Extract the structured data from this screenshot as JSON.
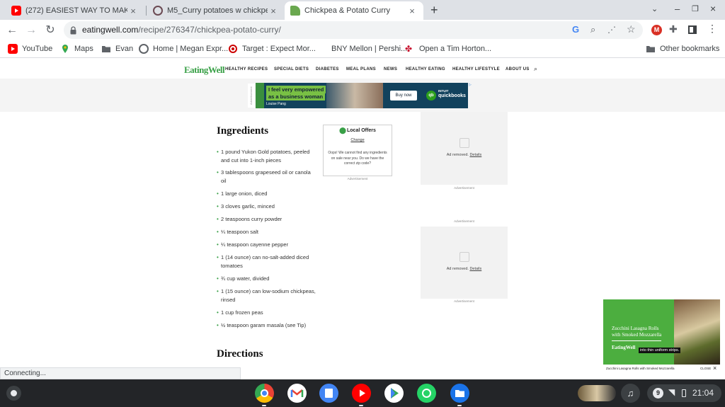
{
  "tabs": [
    {
      "title": "(272) EASIEST WAY TO MAKE A",
      "icon": "youtube-icon"
    },
    {
      "title": "M5_Curry potatoes w chickpea",
      "icon": "circle-site-icon"
    },
    {
      "title": "Chickpea & Potato Curry",
      "icon": "eatingwell-icon"
    }
  ],
  "new_tab_symbol": "+",
  "url": {
    "host": "eatingwell.com",
    "path": "/recipe/276347/chickpea-potato-curry/"
  },
  "bookmarks": [
    {
      "label": "YouTube",
      "icon": "youtube-icon"
    },
    {
      "label": "Maps",
      "icon": "maps-icon"
    },
    {
      "label": "Evan",
      "icon": "folder-icon"
    },
    {
      "label": "Home | Megan Expr...",
      "icon": "circle-site-icon"
    },
    {
      "label": "Target : Expect Mor...",
      "icon": "target-icon"
    },
    {
      "label": "BNY Mellon | Pershi...",
      "icon": "blank-icon"
    },
    {
      "label": "Open a Tim Horton...",
      "icon": "maple-leaf-icon"
    }
  ],
  "other_bookmarks": "Other bookmarks",
  "site": {
    "logo": "EatingWell",
    "nav": [
      "HEALTHY RECIPES",
      "SPECIAL DIETS",
      "DIABETES",
      "MEAL PLANS",
      "NEWS",
      "HEALTHY EATING",
      "HEALTHY LIFESTYLE",
      "ABOUT US"
    ]
  },
  "banner_ad": {
    "headline_line1": "I feel very empowered",
    "headline_line2": "as a business woman",
    "name": "Louise Pang",
    "cta": "Buy now",
    "brand_small": "INTUIT",
    "brand": "quickbooks",
    "side_label": "Advertisement"
  },
  "recipe": {
    "ingredients_heading": "Ingredients",
    "ingredients": [
      "1 pound Yukon Gold potatoes, peeled and cut into 1-inch pieces",
      "3 tablespoons grapeseed oil or canola oil",
      "1 large onion, diced",
      "3 cloves garlic, minced",
      "2 teaspoons curry powder",
      "¼ teaspoon salt",
      "¼ teaspoon cayenne pepper",
      "1 (14 ounce) can no-salt-added diced tomatoes",
      "¾ cup water, divided",
      "1 (15 ounce) can low-sodium chickpeas, rinsed",
      "1 cup frozen peas",
      "½ teaspoon garam masala (see Tip)"
    ],
    "directions_heading": "Directions"
  },
  "local_offers": {
    "title": "Local Offers",
    "change": "Change",
    "message": "Oops! We cannot find any ingredients on sale near you. Do we have the correct zip code?",
    "ad_label": "Advertisement"
  },
  "ad_placeholders": {
    "text": "Ad removed.",
    "link": "Details",
    "label": "Advertisement"
  },
  "video": {
    "title_line1": "Zucchini Lasagna Rolls",
    "title_line2": "with Smoked Mozzarella",
    "logo": "EatingWell",
    "caption": "into thin uniform strips.",
    "footer_title": "Zucchini Lasagna Rolls with Smoked Mozzarella",
    "close": "CLOSE"
  },
  "status_text": "Connecting...",
  "shelf": {
    "apps": [
      "chrome-icon",
      "gmail-icon",
      "docs-icon",
      "youtube-icon",
      "play-store-icon",
      "whatsapp-icon",
      "files-icon"
    ],
    "notification_count": "9",
    "time": "21:04"
  },
  "colors": {
    "accent": "#39a047",
    "tabstrip": "#dee1e6",
    "shelf": "#232528",
    "ad_bg": "#12425d"
  }
}
